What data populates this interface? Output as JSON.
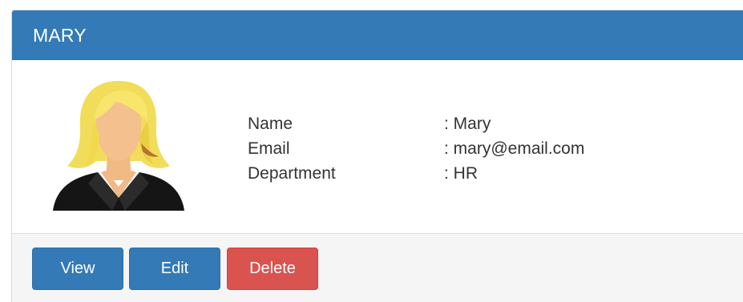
{
  "panel": {
    "title": "MARY"
  },
  "profile": {
    "avatar_icon": "female-avatar-icon",
    "fields": [
      {
        "label": "Name",
        "value": ": Mary"
      },
      {
        "label": "Email",
        "value": ": mary@email.com"
      },
      {
        "label": "Department",
        "value": ": HR"
      }
    ]
  },
  "actions": {
    "view_label": "View",
    "edit_label": "Edit",
    "delete_label": "Delete"
  },
  "colors": {
    "primary": "#337ab7",
    "danger": "#d9534f",
    "footer_bg": "#f5f5f5"
  }
}
